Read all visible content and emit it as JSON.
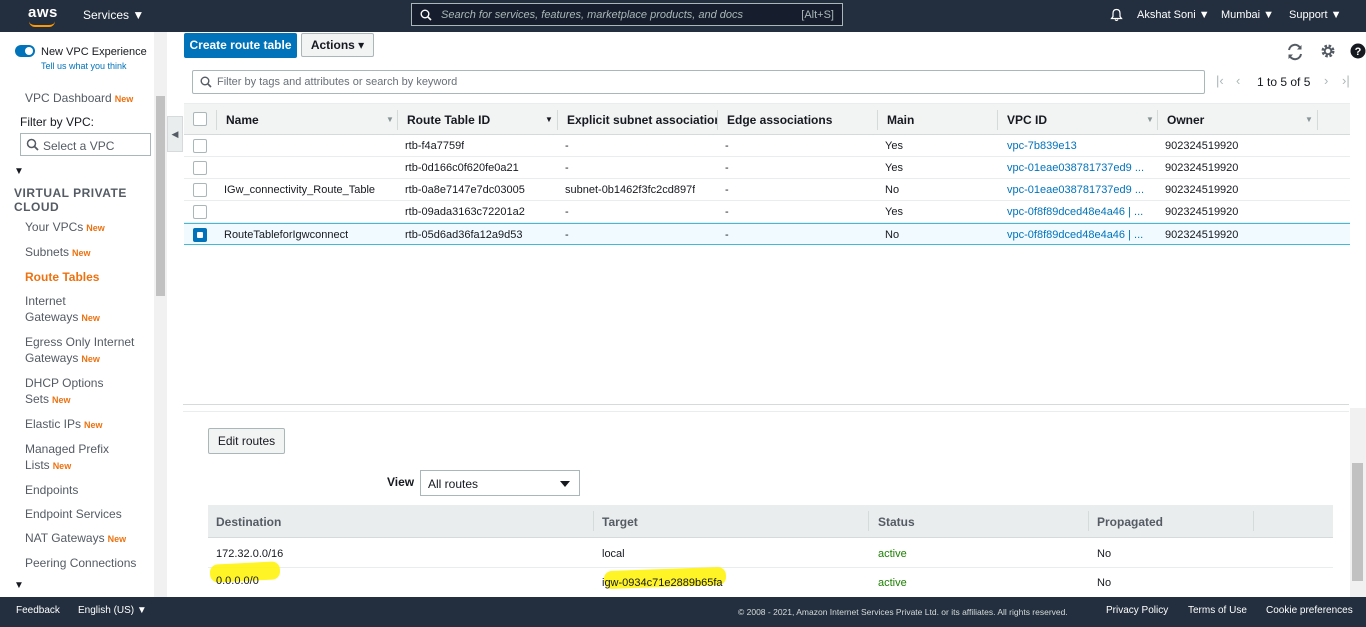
{
  "topbar": {
    "logo": "aws",
    "services": "Services ▼",
    "search_placeholder": "Search for services, features, marketplace products, and docs",
    "search_shortcut": "[Alt+S]",
    "user": "Akshat Soni ▼",
    "region": "Mumbai ▼",
    "support": "Support ▼",
    "icons": [
      "search-icon",
      "bell-icon"
    ]
  },
  "sidebar": {
    "new_vpc_experience": "New VPC Experience",
    "tell_us": "Tell us what you think",
    "dashboard": "VPC Dashboard",
    "filter_label": "Filter by VPC:",
    "vpc_select_placeholder": "Select a VPC",
    "section": "VIRTUAL PRIVATE CLOUD",
    "new_badge": "New",
    "items": [
      {
        "label": "Your VPCs",
        "new": true
      },
      {
        "label": "Subnets",
        "new": true
      },
      {
        "label": "Route Tables",
        "new": false
      },
      {
        "label": "Internet Gateways",
        "new": true
      },
      {
        "label": "Egress Only Internet Gateways",
        "new": true
      },
      {
        "label": "DHCP Options Sets",
        "new": true
      },
      {
        "label": "Elastic IPs",
        "new": true
      },
      {
        "label": "Managed Prefix Lists",
        "new": true
      },
      {
        "label": "Endpoints",
        "new": false
      },
      {
        "label": "Endpoint Services",
        "new": false
      },
      {
        "label": "NAT Gateways",
        "new": true
      },
      {
        "label": "Peering Connections",
        "new": false
      }
    ]
  },
  "toolbar": {
    "create_label": "Create route table",
    "actions_label": "Actions ▾",
    "filter_placeholder": "Filter by tags and attributes or search by keyword",
    "pager_text": "1 to 5 of 5"
  },
  "grid": {
    "columns": [
      "Name",
      "Route Table ID",
      "Explicit subnet associatior",
      "Edge associations",
      "Main",
      "VPC ID",
      "Owner"
    ],
    "rows": [
      {
        "name": "",
        "id": "rtb-f4a7759f",
        "subnet": "-",
        "edge": "-",
        "main": "Yes",
        "vpc": "vpc-7b839e13",
        "owner": "902324519920",
        "selected": false
      },
      {
        "name": "",
        "id": "rtb-0d166c0f620fe0a21",
        "subnet": "-",
        "edge": "-",
        "main": "Yes",
        "vpc": "vpc-01eae038781737ed9 ...",
        "owner": "902324519920",
        "selected": false
      },
      {
        "name": "IGw_connectivity_Route_Table",
        "id": "rtb-0a8e7147e7dc03005",
        "subnet": "subnet-0b1462f3fc2cd897f",
        "edge": "-",
        "main": "No",
        "vpc": "vpc-01eae038781737ed9 ...",
        "owner": "902324519920",
        "selected": false
      },
      {
        "name": "",
        "id": "rtb-09ada3163c72201a2",
        "subnet": "-",
        "edge": "-",
        "main": "Yes",
        "vpc": "vpc-0f8f89dced48e4a46 | ...",
        "owner": "902324519920",
        "selected": false
      },
      {
        "name": "RouteTableforIgwconnect",
        "id": "rtb-05d6ad36fa12a9d53",
        "subnet": "-",
        "edge": "-",
        "main": "No",
        "vpc": "vpc-0f8f89dced48e4a46 | ...",
        "owner": "902324519920",
        "selected": true
      }
    ]
  },
  "routes": {
    "edit_label": "Edit routes",
    "view_label": "View",
    "view_value": "All routes",
    "columns": [
      "Destination",
      "Target",
      "Status",
      "Propagated"
    ],
    "rows": [
      {
        "destination": "172.32.0.0/16",
        "target": "local",
        "status": "active",
        "propagated": "No",
        "highlighted": false
      },
      {
        "destination": "0.0.0.0/0",
        "target": "igw-0934c71e2889b65fa",
        "status": "active",
        "propagated": "No",
        "highlighted": true
      }
    ]
  },
  "footer": {
    "feedback": "Feedback",
    "language": "English (US) ▼",
    "copyright": "© 2008 - 2021, Amazon Internet Services Private Ltd. or its affiliates. All rights reserved.",
    "privacy": "Privacy Policy",
    "terms": "Terms of Use",
    "cookies": "Cookie preferences"
  },
  "colors": {
    "nav_bg": "#232f3e",
    "primary": "#0073bb",
    "accent": "#ec7211",
    "active_status": "#1d8102",
    "highlight": "#fff200"
  }
}
